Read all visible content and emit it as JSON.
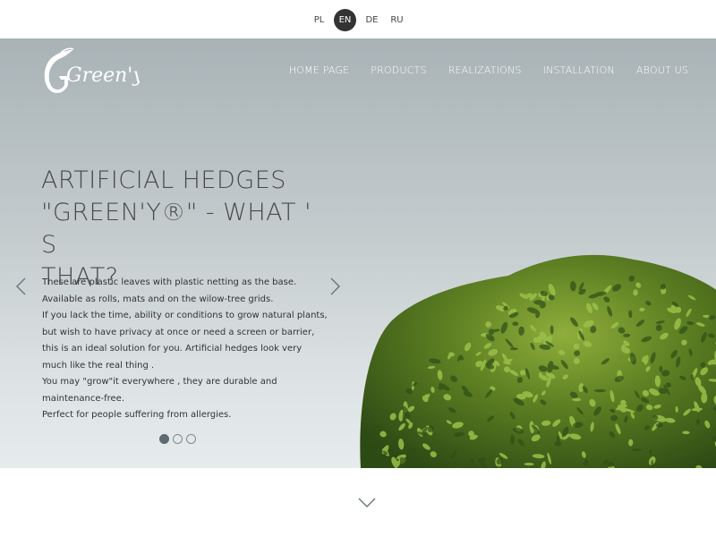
{
  "languages": [
    {
      "code": "PL",
      "active": false
    },
    {
      "code": "EN",
      "active": true
    },
    {
      "code": "DE",
      "active": false
    },
    {
      "code": "RU",
      "active": false
    }
  ],
  "logo": {
    "text": "Green'y"
  },
  "nav": [
    "HOME PAGE",
    "PRODUCTS",
    "REALIZATIONS",
    "INSTALLATION",
    "ABOUT US"
  ],
  "hero": {
    "headline_line1": "ARTIFICIAL HEDGES",
    "headline_line2": "\"GREEN'Y®\" - WHAT ' S",
    "headline_line3": "THAT?",
    "paragraphs": [
      "These are plastic leaves with plastic netting as the base.  Available as rolls, mats and on the wilow-tree grids.",
      "If you lack the time, ability or conditions to grow natural plants, but wish to have privacy at once or need a screen or barrier, this is an ideal solution for you. Artificial hedges look very much like the real thing .",
      "You may \"grow\"it everywhere , they are durable and maintenance-free.",
      "Perfect for people suffering from allergies."
    ],
    "slides": {
      "count": 3,
      "active": 1
    }
  },
  "colors": {
    "accent": "#7a6a5a",
    "active_lang_bg": "#333333",
    "hero_top": "#a9b3b6",
    "hero_bottom": "#e6ebec"
  },
  "icons": [
    "chevron-left-icon",
    "chevron-right-icon",
    "chevron-down-icon",
    "hedge-bush-image"
  ]
}
